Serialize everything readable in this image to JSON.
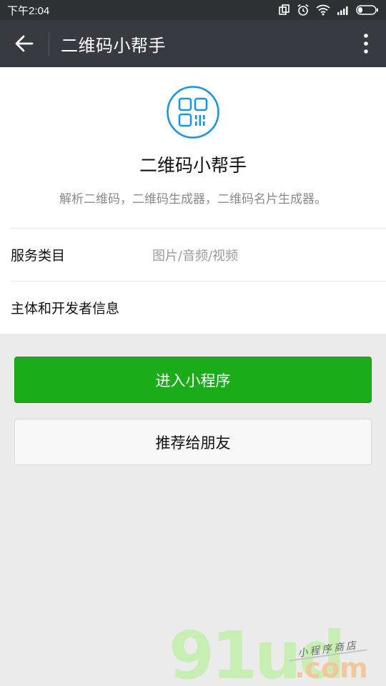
{
  "status_bar": {
    "time": "下午2:04"
  },
  "app_bar": {
    "title": "二维码小帮手",
    "back_icon": "arrow-left-icon",
    "more_icon": "more-vertical-icon"
  },
  "profile": {
    "logo_icon": "qr-code-icon",
    "name": "二维码小帮手",
    "description": "解析二维码，二维码生成器，二维码名片生成器。"
  },
  "details": [
    {
      "label": "服务类目",
      "value": "图片/音频/视频"
    },
    {
      "label": "主体和开发者信息",
      "value": ""
    }
  ],
  "actions": {
    "enter_label": "进入小程序",
    "share_label": "推荐给朋友"
  },
  "watermark": {
    "brand": "91ud",
    "domain": ".com",
    "tagline": "小程序商店"
  },
  "colors": {
    "status_bar": "#2e3132",
    "app_bar": "#393a3f",
    "primary_green": "#1aad19",
    "logo_blue": "#1b95e0"
  }
}
